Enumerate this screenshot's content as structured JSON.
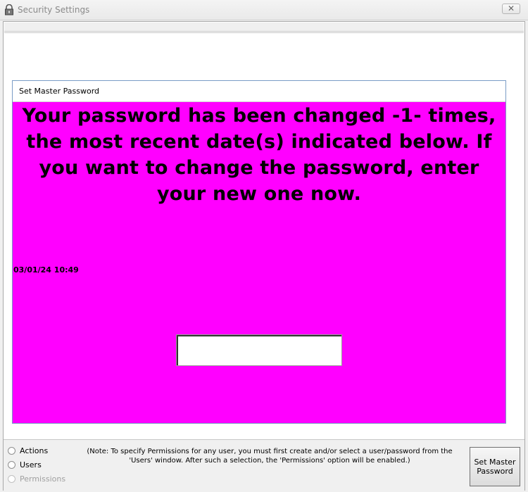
{
  "window": {
    "title": "Security Settings",
    "close_glyph": "✕",
    "icon": "lock-icon"
  },
  "panel": {
    "header": "Set Master Password",
    "background_color": "#ff00ff",
    "message": "Your password has been changed -1- times, the most recent date(s) indicated below.  If you want to change the password, enter your new one now.",
    "dates": [
      "03/01/24 10:49"
    ],
    "password_value": ""
  },
  "bottom": {
    "options": [
      {
        "label": "Actions",
        "enabled": true,
        "selected": false
      },
      {
        "label": "Users",
        "enabled": true,
        "selected": false
      },
      {
        "label": "Permissions",
        "enabled": false,
        "selected": false
      }
    ],
    "note": "(Note: To specify Permissions for any user, you must first create and/or select a user/password from the 'Users' window.  After such a selection, the 'Permissions' option will be enabled.)",
    "set_button_label": "Set Master Password"
  }
}
